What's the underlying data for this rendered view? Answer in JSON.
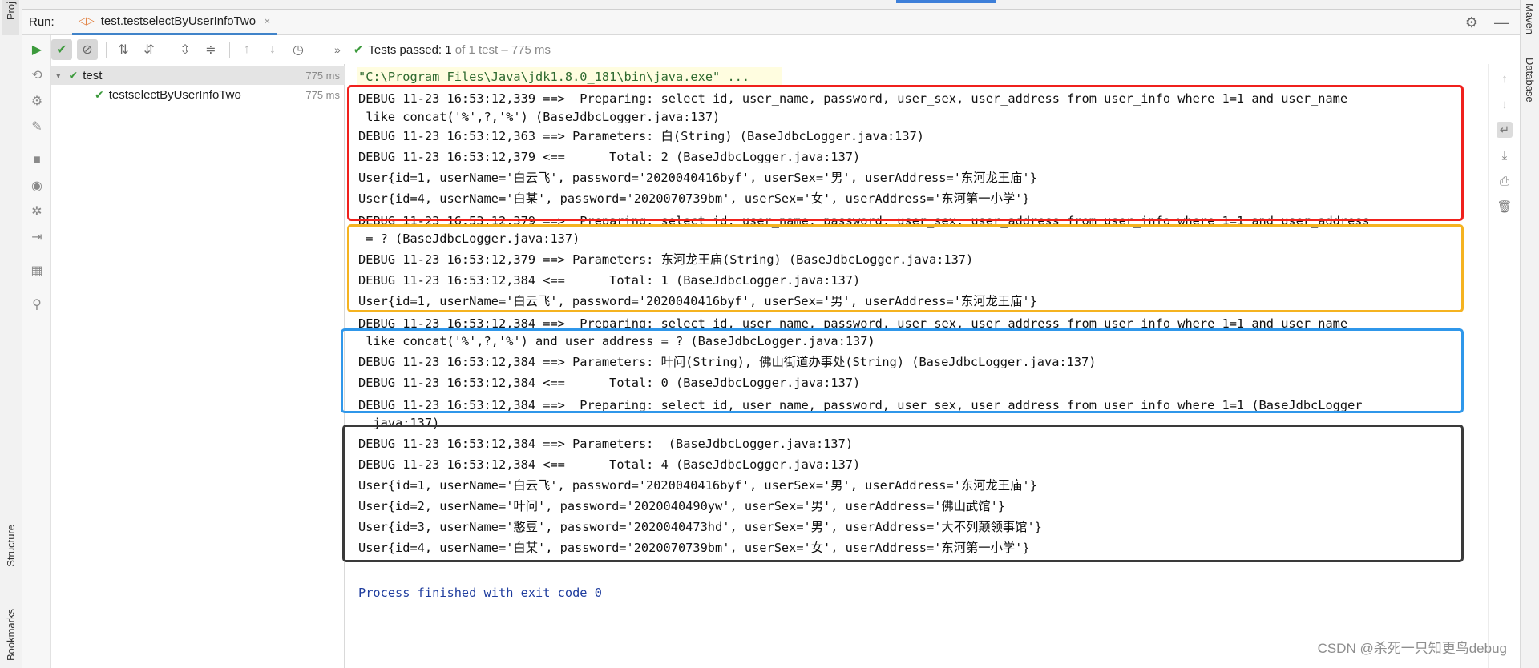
{
  "left_strip": {
    "project_label": "Proj",
    "structure_label": "Structure",
    "bookmarks_label": "Bookmarks"
  },
  "right_strip": {
    "maven_label": "Maven",
    "database_label": "Database"
  },
  "run": {
    "label": "Run:",
    "tab_title": "test.testselectByUserInfoTwo",
    "tab_close": "×"
  },
  "toolbar": {
    "status_prefix": "Tests passed:",
    "passed_count": "1",
    "status_suffix": "of 1 test – 775 ms",
    "chevron": "»"
  },
  "tree": {
    "root": {
      "label": "test",
      "time": "775 ms"
    },
    "child": {
      "label": "testselectByUserInfoTwo",
      "time": "775 ms"
    }
  },
  "console": {
    "command": "\"C:\\Program Files\\Java\\jdk1.8.0_181\\bin\\java.exe\" ...",
    "lines": [
      "DEBUG 11-23 16:53:12,339 ==>  Preparing: select id, user_name, password, user_sex, user_address from user_info where 1=1 and user_name",
      " like concat('%',?,'%') (BaseJdbcLogger.java:137)",
      "DEBUG 11-23 16:53:12,363 ==> Parameters: 白(String) (BaseJdbcLogger.java:137)",
      "DEBUG 11-23 16:53:12,379 <==      Total: 2 (BaseJdbcLogger.java:137)",
      "User{id=1, userName='白云飞', password='2020040416byf', userSex='男', userAddress='东河龙王庙'}",
      "User{id=4, userName='白某', password='2020070739bm', userSex='女', userAddress='东河第一小学'}",
      "DEBUG 11-23 16:53:12,379 ==>  Preparing: select id, user_name, password, user_sex, user_address from user_info where 1=1 and user_address",
      " = ? (BaseJdbcLogger.java:137)",
      "DEBUG 11-23 16:53:12,379 ==> Parameters: 东河龙王庙(String) (BaseJdbcLogger.java:137)",
      "DEBUG 11-23 16:53:12,384 <==      Total: 1 (BaseJdbcLogger.java:137)",
      "User{id=1, userName='白云飞', password='2020040416byf', userSex='男', userAddress='东河龙王庙'}",
      "DEBUG 11-23 16:53:12,384 ==>  Preparing: select id, user_name, password, user_sex, user_address from user_info where 1=1 and user_name",
      " like concat('%',?,'%') and user_address = ? (BaseJdbcLogger.java:137)",
      "DEBUG 11-23 16:53:12,384 ==> Parameters: 叶问(String), 佛山街道办事处(String) (BaseJdbcLogger.java:137)",
      "DEBUG 11-23 16:53:12,384 <==      Total: 0 (BaseJdbcLogger.java:137)",
      "DEBUG 11-23 16:53:12,384 ==>  Preparing: select id, user_name, password, user_sex, user_address from user_info where 1=1 (BaseJdbcLogger",
      " .java:137)",
      "DEBUG 11-23 16:53:12,384 ==> Parameters:  (BaseJdbcLogger.java:137)",
      "DEBUG 11-23 16:53:12,384 <==      Total: 4 (BaseJdbcLogger.java:137)",
      "User{id=1, userName='白云飞', password='2020040416byf', userSex='男', userAddress='东河龙王庙'}",
      "User{id=2, userName='叶问', password='2020040490yw', userSex='男', userAddress='佛山武馆'}",
      "User{id=3, userName='憨豆', password='2020040473hd', userSex='男', userAddress='大不列颠领事馆'}",
      "User{id=4, userName='白某', password='2020070739bm', userSex='女', userAddress='东河第一小学'}"
    ],
    "exit_message": "Process finished with exit code 0"
  },
  "highlight_colors": {
    "box1": "#f0201c",
    "box2": "#f5b320",
    "box3": "#2f97ea",
    "box4": "#3a3a3a"
  },
  "watermark": "CSDN @杀死一只知更鸟debug"
}
